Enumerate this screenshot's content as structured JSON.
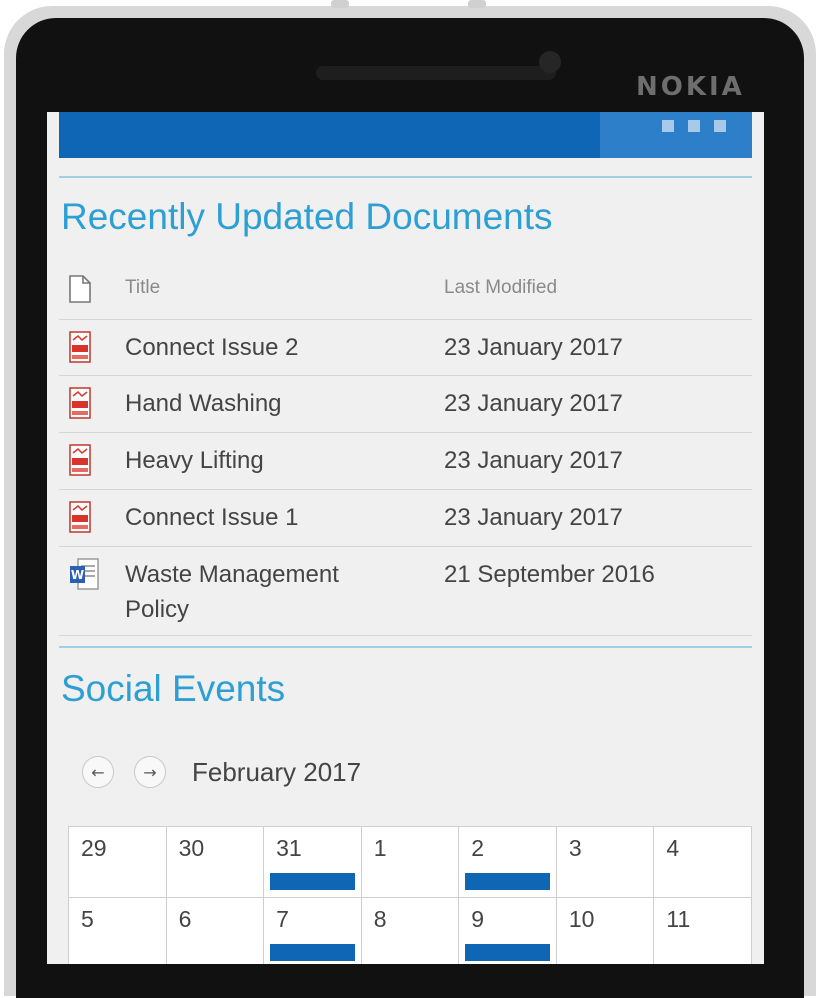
{
  "device": {
    "brand": "NOKIA"
  },
  "documents": {
    "heading": "Recently Updated Documents",
    "columns": {
      "title": "Title",
      "modified": "Last Modified"
    },
    "rows": [
      {
        "title": "Connect Issue 2",
        "modified": "23 January 2017",
        "icon": "pdf-file-icon"
      },
      {
        "title": "Hand Washing",
        "modified": "23 January 2017",
        "icon": "pdf-file-icon"
      },
      {
        "title": "Heavy Lifting",
        "modified": "23 January 2017",
        "icon": "pdf-file-icon"
      },
      {
        "title": "Connect Issue 1",
        "modified": "23 January 2017",
        "icon": "pdf-file-icon"
      },
      {
        "title_line1": "Waste Management",
        "title_line2": "Policy",
        "modified": "21 September 2016",
        "icon": "word-file-icon"
      }
    ]
  },
  "events": {
    "heading": "Social Events",
    "month": "February 2017",
    "prev_icon": "arrow-left-icon",
    "next_icon": "arrow-right-icon",
    "weeks": [
      [
        {
          "day": "29",
          "event": false
        },
        {
          "day": "30",
          "event": false
        },
        {
          "day": "31",
          "event": true
        },
        {
          "day": "1",
          "event": false
        },
        {
          "day": "2",
          "event": true
        },
        {
          "day": "3",
          "event": false
        },
        {
          "day": "4",
          "event": false
        }
      ],
      [
        {
          "day": "5",
          "event": false
        },
        {
          "day": "6",
          "event": false
        },
        {
          "day": "7",
          "event": true
        },
        {
          "day": "8",
          "event": false
        },
        {
          "day": "9",
          "event": true
        },
        {
          "day": "10",
          "event": false
        },
        {
          "day": "11",
          "event": false
        }
      ]
    ]
  },
  "colors": {
    "accent": "#2e9fd3",
    "banner": "#0f66b5",
    "event": "#0f66b5"
  }
}
